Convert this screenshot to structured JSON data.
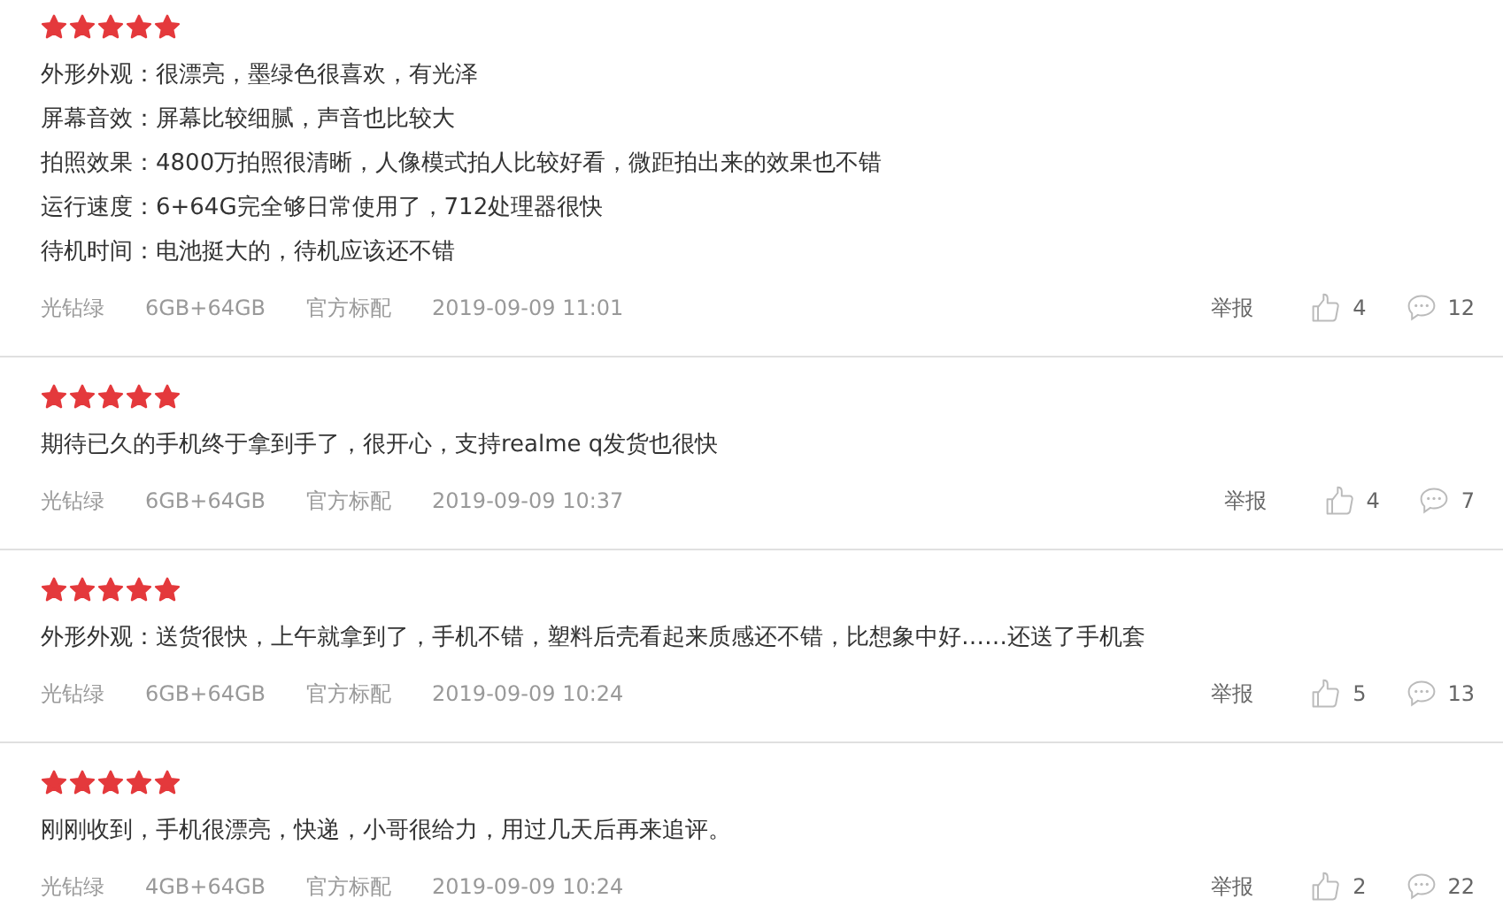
{
  "reviews": [
    {
      "stars": 5,
      "lines": [
        "外形外观：很漂亮，墨绿色很喜欢，有光泽",
        "屏幕音效：屏幕比较细腻，声音也比较大",
        "拍照效果：4800万拍照很清晰，人像模式拍人比较好看，微距拍出来的效果也不错",
        "运行速度：6+64G完全够日常使用了，712处理器很快",
        "待机时间：电池挺大的，待机应该还不错"
      ],
      "color_name": "光钻绿",
      "spec": "6GB+64GB",
      "package": "官方标配",
      "time": "2019-09-09 11:01",
      "report": "举报",
      "likes": "4",
      "comments": "12"
    },
    {
      "stars": 5,
      "lines": [
        "期待已久的手机终于拿到手了，很开心，支持realme q发货也很快"
      ],
      "color_name": "光钻绿",
      "spec": "6GB+64GB",
      "package": "官方标配",
      "time": "2019-09-09 10:37",
      "report": "举报",
      "likes": "4",
      "comments": "7"
    },
    {
      "stars": 5,
      "lines": [
        "外形外观：送货很快，上午就拿到了，手机不错，塑料后壳看起来质感还不错，比想象中好……还送了手机套"
      ],
      "color_name": "光钻绿",
      "spec": "6GB+64GB",
      "package": "官方标配",
      "time": "2019-09-09 10:24",
      "report": "举报",
      "likes": "5",
      "comments": "13"
    },
    {
      "stars": 5,
      "lines": [
        "刚刚收到，手机很漂亮，快递，小哥很给力，用过几天后再来追评。"
      ],
      "color_name": "光钻绿",
      "spec": "4GB+64GB",
      "package": "官方标配",
      "time": "2019-09-09 10:24",
      "report": "举报",
      "likes": "2",
      "comments": "22"
    }
  ]
}
